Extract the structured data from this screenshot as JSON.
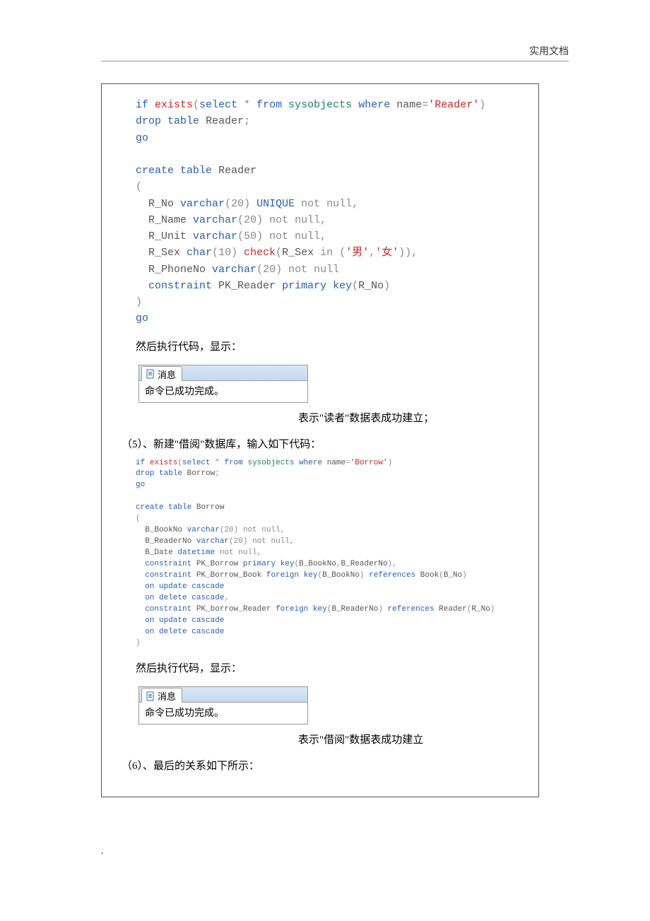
{
  "header": {
    "label": "实用文档"
  },
  "code1": {
    "l01a": "if",
    "l01b": "exists",
    "l01c": "select",
    "l01d": "from",
    "l01e": "sysobjects",
    "l01f": "where",
    "l01g": "name",
    "l01h": "'Reader'",
    "l02a": "drop",
    "l02b": "table",
    "l02c": "Reader",
    "l03a": "go",
    "l05a": "create",
    "l05b": "table",
    "l05c": "Reader",
    "l06a": "(",
    "l07a": "R_No",
    "l07b": "varchar",
    "l07c": "(20)",
    "l07d": "UNIQUE",
    "l07e": "not",
    "l07f": "null",
    "l08a": "R_Name",
    "l08b": "varchar",
    "l08c": "(20)",
    "l08d": "not",
    "l08e": "null",
    "l09a": "R_Unit",
    "l09b": "varchar",
    "l09c": "(50)",
    "l09d": "not",
    "l09e": "null",
    "l10a": "R_Sex",
    "l10b": "char",
    "l10c": "(10)",
    "l10d": "check",
    "l10e": "R_Sex",
    "l10f": "in",
    "l10g": "'男'",
    "l10h": "'女'",
    "l11a": "R_PhoneNo",
    "l11b": "varchar",
    "l11c": "(20)",
    "l11d": "not",
    "l11e": "null",
    "l12a": "constraint",
    "l12b": "PK_Reader",
    "l12c": "primary",
    "l12d": "key",
    "l12e": "R_No",
    "l13a": ")",
    "l14a": "go"
  },
  "para1": "然后执行代码，显示：",
  "msg1": {
    "tab": "消息",
    "body": "命令已成功完成。"
  },
  "caption1": "表示\"读者\"数据表成功建立；",
  "para2": "（5）、新建\"借阅\"数据库，输入如下代码：",
  "code2": {
    "l01a": "if",
    "l01b": "exists",
    "l01c": "select",
    "l01d": "from",
    "l01e": "sysobjects",
    "l01f": "where",
    "l01g": "name",
    "l01h": "'Borrow'",
    "l02a": "drop",
    "l02b": "table",
    "l02c": "Borrow",
    "l03a": "go",
    "l05a": "create",
    "l05b": "table",
    "l05c": "Borrow",
    "l06a": "(",
    "l07a": "B_BookNo",
    "l07b": "varchar",
    "l07c": "(20)",
    "l07d": "not",
    "l07e": "null",
    "l08a": "B_ReaderNo",
    "l08b": "varchar",
    "l08c": "(20)",
    "l08d": "not",
    "l08e": "null",
    "l09a": "B_Date",
    "l09b": "datetime",
    "l09c": "not",
    "l09d": "null",
    "l10a": "constraint",
    "l10b": "PK_Borrow",
    "l10c": "primary",
    "l10d": "key",
    "l10e": "B_BookNo",
    "l10f": "B_ReaderNo",
    "l11a": "constraint",
    "l11b": "PK_Borrow_Book",
    "l11c": "foreign",
    "l11d": "key",
    "l11e": "B_BookNo",
    "l11f": "references",
    "l11g": "Book",
    "l11h": "B_No",
    "l12a": "on",
    "l12b": "update",
    "l12c": "cascade",
    "l13a": "on",
    "l13b": "delete",
    "l13c": "cascade",
    "l14a": "constraint",
    "l14b": "PK_borrow_Reader",
    "l14c": "foreign",
    "l14d": "key",
    "l14e": "B_ReaderNo",
    "l14f": "references",
    "l14g": "Reader",
    "l14h": "R_No",
    "l15a": "on",
    "l15b": "update",
    "l15c": "cascade",
    "l16a": "on",
    "l16b": "delete",
    "l16c": "cascade",
    "l17a": ")"
  },
  "para3": "然后执行代码，显示：",
  "msg2": {
    "tab": "消息",
    "body": "命令已成功完成。"
  },
  "caption2": "表示\"借阅\"数据表成功建立",
  "para4": "（6）、最后的关系如下所示：",
  "footer_dot": "."
}
